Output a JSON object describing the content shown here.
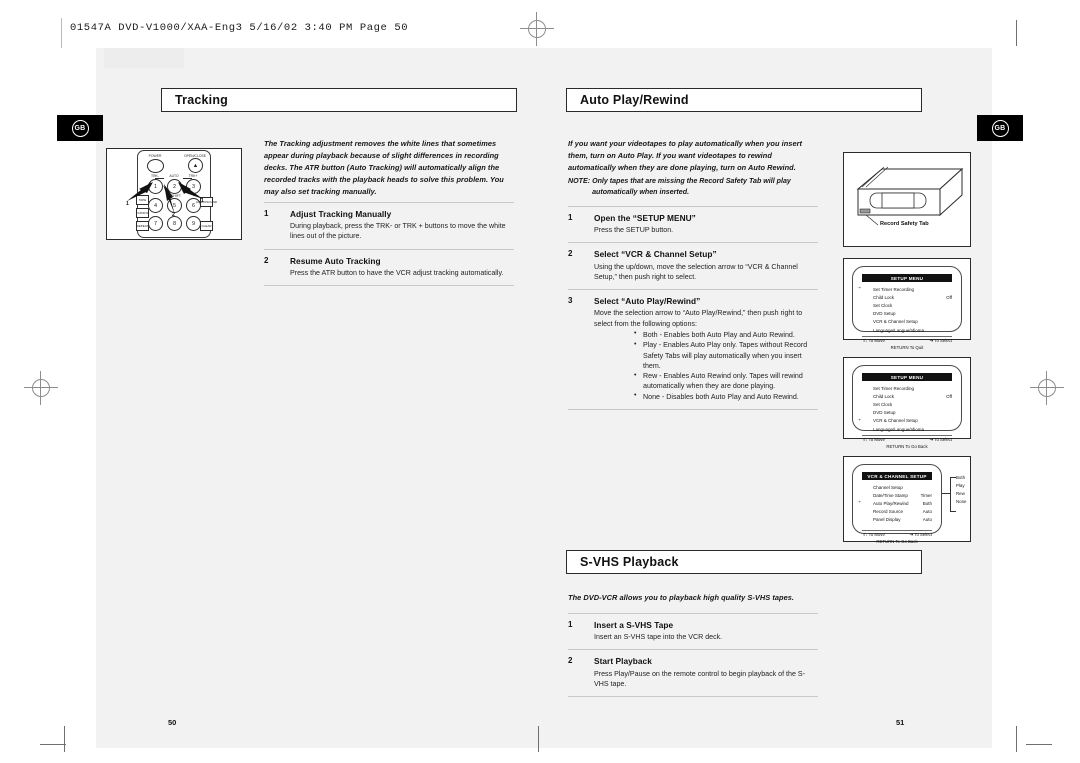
{
  "slug": "01547A  DVD-V1000/XAA-Eng3   5/16/02 3:40 PM   Page 50",
  "language_tab": "GB",
  "left_page": {
    "title": "Tracking",
    "page_number": "50",
    "intro": "The Tracking adjustment removes the white lines that sometimes appear during playback because of slight differences in recording decks. The ATR button (Auto Tracking) will automatically align the recorded tracks with the playback heads to solve this problem. You may also set tracking manually.",
    "steps": [
      {
        "num": "1",
        "title": "Adjust Tracking Manually",
        "body": "During playback, press the TRK- or TRK + buttons to move the white lines out of the picture."
      },
      {
        "num": "2",
        "title": "Resume Auto Tracking",
        "body": "Press the ATR button to have the VCR adjust tracking automatically."
      }
    ],
    "remote": {
      "power_label": "POWER",
      "open_close_label": "OPEN/CLOSE",
      "trk_minus_label": "TRK-",
      "auto_label": "AUTO",
      "trk_plus_label": "TRK+",
      "shift_label": "SHIFT",
      "minus_label": "-",
      "plus_label": "+",
      "keys": [
        "1",
        "2",
        "3",
        "4",
        "5",
        "6",
        "7",
        "8",
        "9"
      ],
      "side_left": [
        "TAPE",
        "VCR/DVD",
        "REPEAT",
        "SKIP",
        "FIRST"
      ],
      "side_right": [
        "AUDIO/SOUND",
        "TITLE",
        "CLEAR"
      ],
      "pointers": [
        "1",
        "2",
        "1"
      ]
    }
  },
  "right_page": {
    "page_number": "51",
    "sections": [
      {
        "title": "Auto Play/Rewind",
        "intro": "If you want your videotapes to play automatically when you insert them, turn on Auto Play. If you want videotapes to rewind automatically when they are done playing, turn on Auto Rewind.",
        "note_label": "NOTE:",
        "note_body": "Only tapes that are missing the Record Safety Tab will play automatically when inserted.",
        "steps": [
          {
            "num": "1",
            "title": "Open the “SETUP MENU”",
            "body": "Press the SETUP button.",
            "bullets": []
          },
          {
            "num": "2",
            "title": "Select “VCR & Channel Setup”",
            "body": "Using the up/down, move the selection arrow to “VCR & Channel Setup,” then push right to select.",
            "bullets": []
          },
          {
            "num": "3",
            "title": "Select “Auto Play/Rewind”",
            "body": "Move the selection arrow to “Auto Play/Rewind,” then push right to select from the following options:",
            "bullets": [
              "Both - Enables both Auto Play and Auto Rewind.",
              "Play - Enables Auto Play only. Tapes without Record Safety Tabs will play automatically when you insert them.",
              "Rew - Enables Auto Rewind only. Tapes will rewind automatically when they are done playing.",
              "None - Disables both Auto Play and Auto Rewind."
            ]
          }
        ]
      },
      {
        "title": "S-VHS Playback",
        "intro": "The DVD-VCR allows you to playback high quality S-VHS tapes.",
        "steps": [
          {
            "num": "1",
            "title": "Insert a S-VHS Tape",
            "body": "Insert an S-VHS tape into the VCR deck.",
            "bullets": []
          },
          {
            "num": "2",
            "title": "Start Playback",
            "body": "Press Play/Pause on the remote control to begin playback of the S-VHS tape.",
            "bullets": []
          }
        ]
      }
    ],
    "cassette": {
      "caption": "Record Safety Tab"
    },
    "menus": [
      {
        "title": "SETUP MENU",
        "rows": [
          {
            "label": "Set Timer Recording",
            "value": "",
            "selected": true
          },
          {
            "label": "Child Lock",
            "value": "Off",
            "selected": false
          },
          {
            "label": "Set Clock",
            "value": "",
            "selected": false
          },
          {
            "label": "DVD Setup",
            "value": "",
            "selected": false
          },
          {
            "label": "VCR & Channel Setup",
            "value": "",
            "selected": false
          },
          {
            "label": "Language/Langue/Idioma",
            "value": "",
            "selected": false
          }
        ],
        "foot_left": "↑/↓ To  Move",
        "foot_right": "➔ To Select",
        "foot_bottom": "RETURN To Quit"
      },
      {
        "title": "SETUP MENU",
        "rows": [
          {
            "label": "Set Timer Recording",
            "value": "",
            "selected": false
          },
          {
            "label": "Child Lock",
            "value": "Off",
            "selected": false
          },
          {
            "label": "Set Clock",
            "value": "",
            "selected": false
          },
          {
            "label": "DVD Setup",
            "value": "",
            "selected": false
          },
          {
            "label": "VCR & Channel Setup",
            "value": "",
            "selected": true
          },
          {
            "label": "Language/Langue/Idioma",
            "value": "",
            "selected": false
          }
        ],
        "foot_left": "↑/↓ To  Move",
        "foot_right": "➔ To Select",
        "foot_bottom": "RETURN To Go Back"
      },
      {
        "title": "VCR & CHANNEL SETUP",
        "rows": [
          {
            "label": "Channel Setup",
            "value": "",
            "selected": false
          },
          {
            "label": "Date/Time Stamp",
            "value": "Timer",
            "selected": false
          },
          {
            "label": "Auto Play/Rewind",
            "value": "Both",
            "selected": true
          },
          {
            "label": "Record Source",
            "value": "Auto",
            "selected": false
          },
          {
            "label": "Panel Display",
            "value": "Auto",
            "selected": false
          }
        ],
        "options": [
          "Both",
          "Play",
          "Rew",
          "None"
        ],
        "foot_left": "↑/↓ To  Move",
        "foot_right": "➔ To Select",
        "foot_bottom": "RETURN To Go Back"
      }
    ]
  }
}
